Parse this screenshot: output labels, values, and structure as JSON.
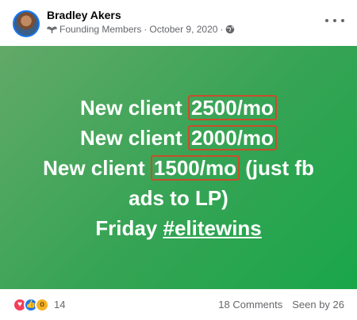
{
  "post": {
    "author": "Bradley Akers",
    "group_label": "Founding Members",
    "separator": "·",
    "date": "October 9, 2020",
    "more_icon": "ellipsis-icon",
    "badge_icon": "founding-member-badge-icon",
    "audience_icon": "globe-icon"
  },
  "content": {
    "background_colors": [
      "#62a968",
      "#1aa64a"
    ],
    "highlight_color": "#c94d2c",
    "line1_prefix": "New client",
    "line1_value": "2500/mo",
    "line2_prefix": "New client",
    "line2_value": "2000/mo",
    "line3_prefix": "New client",
    "line3_value": "1500/mo",
    "line3_suffix": "(just fb",
    "line4": "ads to LP)",
    "line5_prefix": "Friday",
    "hashtag": "#elitewins"
  },
  "footer": {
    "reaction_icons": [
      "love-icon",
      "like-icon",
      "wow-icon"
    ],
    "reaction_count": "14",
    "comments": "18 Comments",
    "seen": "Seen by 26"
  }
}
